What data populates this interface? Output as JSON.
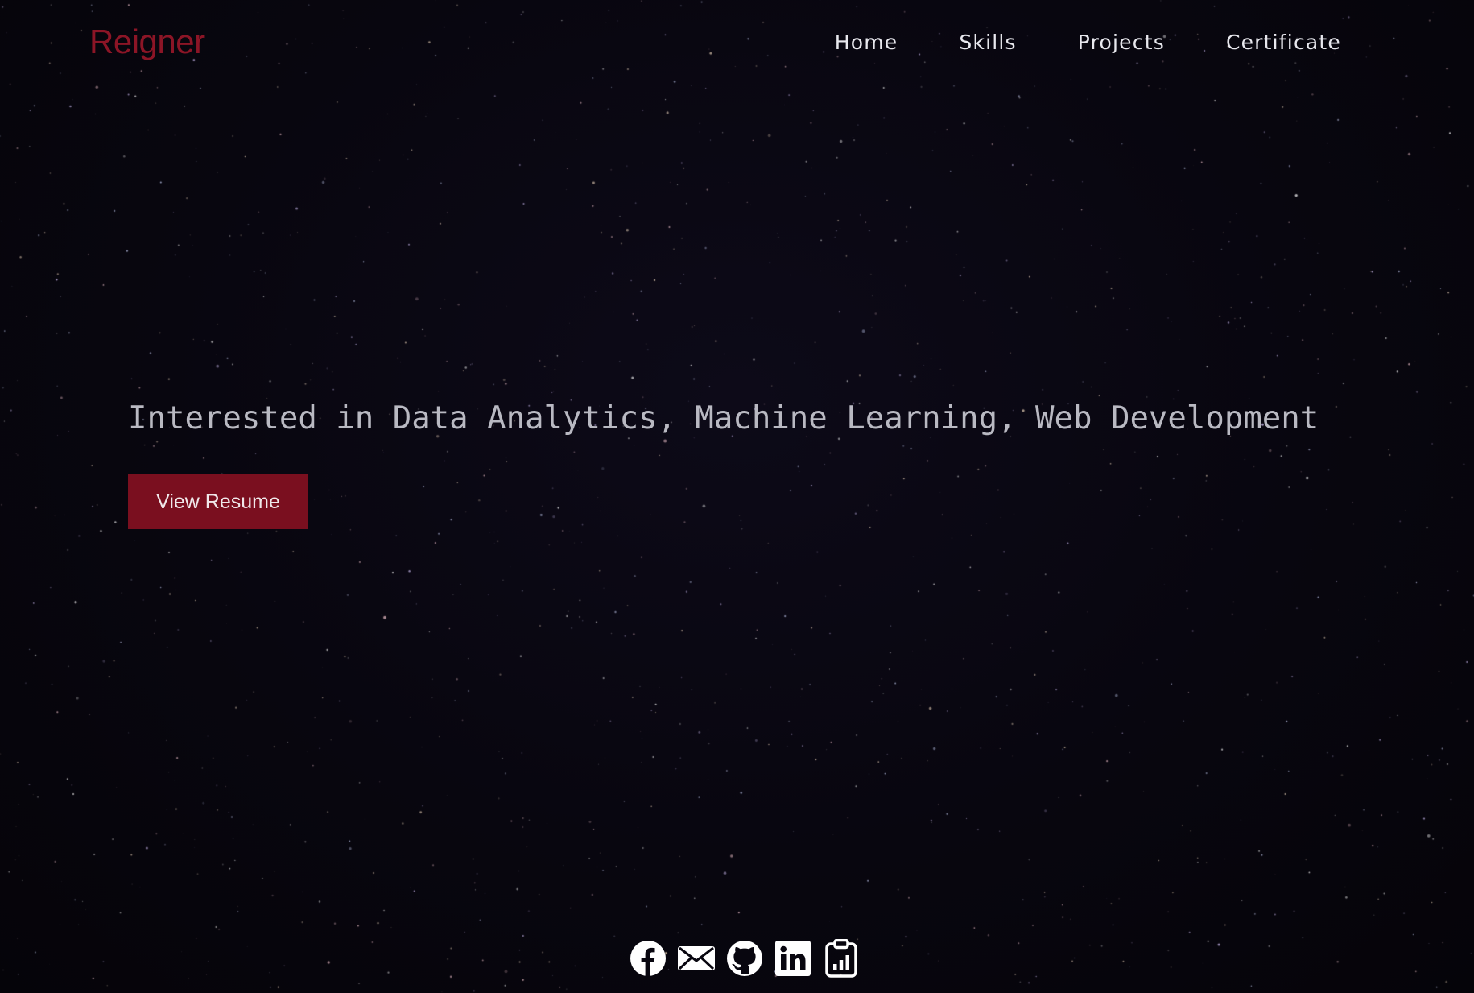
{
  "brand": {
    "logo_text": "Reigner",
    "accent_color": "#8c1526"
  },
  "nav": {
    "items": [
      {
        "label": "Home"
      },
      {
        "label": "Skills"
      },
      {
        "label": "Projects"
      },
      {
        "label": "Certificate"
      }
    ]
  },
  "hero": {
    "tagline": "Interested in Data Analytics, Machine Learning, Web Development",
    "resume_button_label": "View Resume",
    "button_color": "#7a0f1f"
  },
  "socials": {
    "icons": [
      "facebook-icon",
      "email-icon",
      "github-icon",
      "linkedin-icon",
      "clipboard-chart-icon"
    ]
  }
}
